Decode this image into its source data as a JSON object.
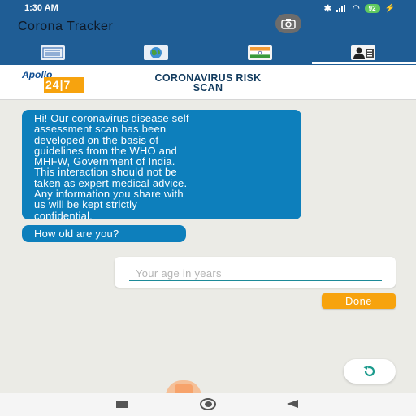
{
  "status_bar": {
    "time": "1:30 AM",
    "battery": "92",
    "icons": [
      "bluetooth-icon",
      "signal-icon",
      "wifi-icon",
      "battery-icon",
      "charging-icon"
    ]
  },
  "app_bar": {
    "title": "Corona Tracker",
    "camera_icon": "camera-icon"
  },
  "tabs": [
    {
      "icon": "news-icon"
    },
    {
      "icon": "globe-icon"
    },
    {
      "icon": "india-flag-icon"
    },
    {
      "icon": "doctor-icon",
      "selected": true
    }
  ],
  "header": {
    "logo_apollo": "Apollo",
    "logo_247": "24|7",
    "title_line1": "CORONAVIRUS RISK",
    "title_line2": "SCAN"
  },
  "chat": {
    "intro_lines": [
      "Hi! Our coronavirus disease self",
      "assessment scan has been",
      "developed on the basis of",
      "guidelines from the WHO and",
      "MHFW, Government of India.",
      "This interaction should not be",
      "taken as expert medical advice.",
      "Any information you share with",
      "us will be kept strictly",
      "confidential."
    ],
    "question": "How old are you?"
  },
  "age_input": {
    "value": "",
    "placeholder": "Your age in years"
  },
  "done_button": "Done",
  "colors": {
    "app_bar": "#1f5d95",
    "bubble": "#0d7fbc",
    "accent_orange": "#f7a30e",
    "background": "#ebebe6",
    "input_underline": "#1d8a98"
  }
}
